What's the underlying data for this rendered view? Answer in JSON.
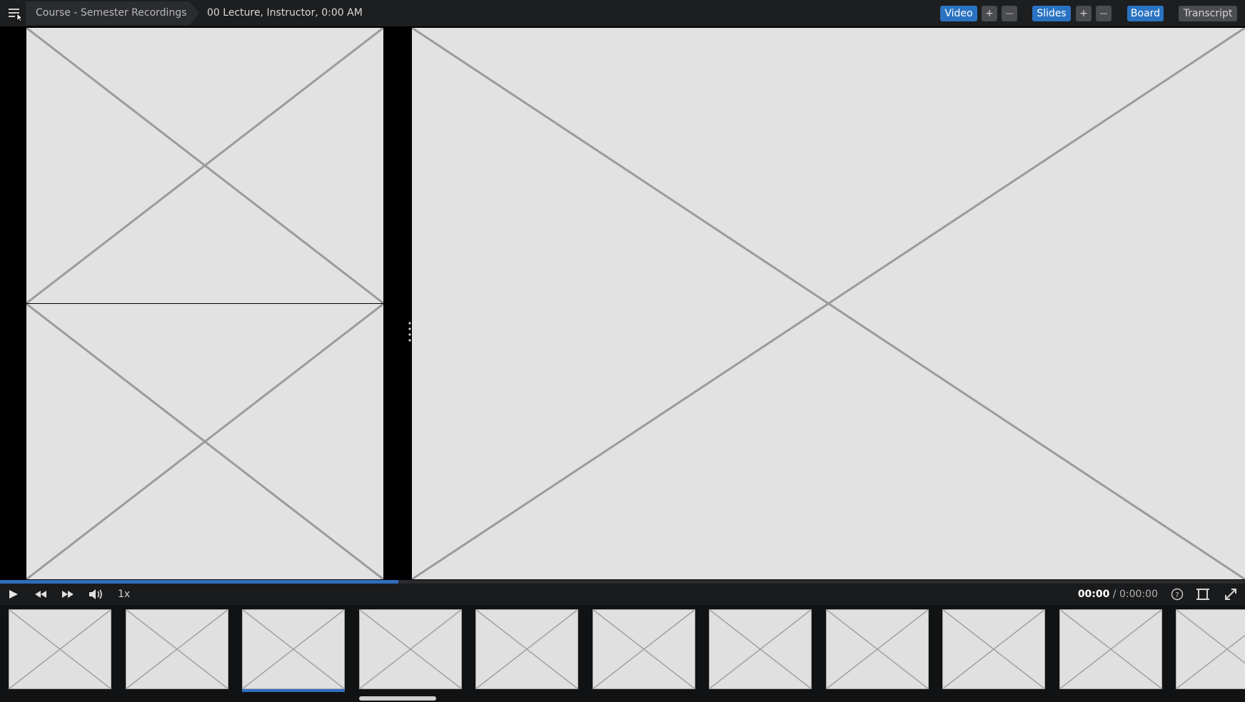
{
  "header": {
    "course_title": "Course - Semester Recordings",
    "lecture_title": "00 Lecture, Instructor, 0:00 AM",
    "video_label": "Video",
    "slides_label": "Slides",
    "board_label": "Board",
    "transcript_label": "Transcript",
    "plus_glyph": "+",
    "minus_glyph": "—",
    "menu_icon": "menu-icon"
  },
  "player": {
    "speed": "1x",
    "current_time": "00:00",
    "separator": "/",
    "duration": "0:00:00",
    "progress_fraction": 0.32
  },
  "thumbnails": {
    "count": 11,
    "selected_index": 2
  },
  "colors": {
    "accent": "#2a73c2",
    "topbar": "#1d1e20",
    "placeholder": "#e2e2e2",
    "placeholder_lines": "#9b9b9b"
  }
}
